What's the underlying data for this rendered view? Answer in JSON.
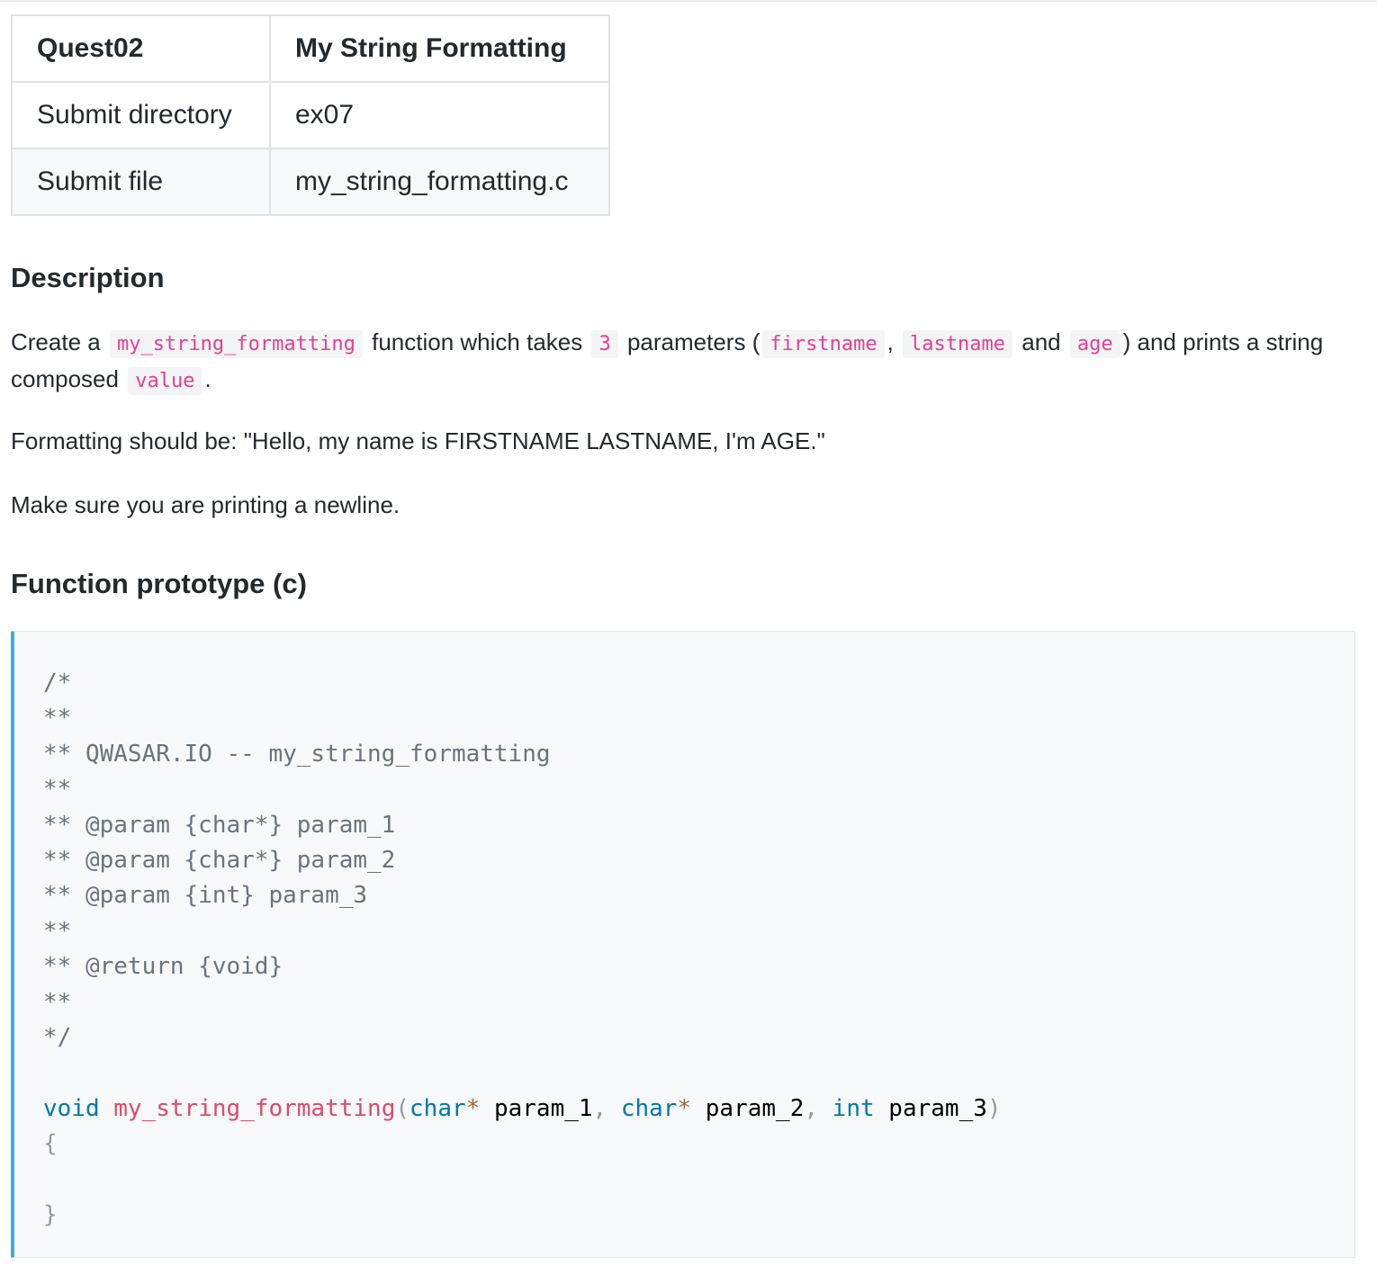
{
  "info_table": {
    "header": [
      "Quest02",
      "My String Formatting"
    ],
    "rows": [
      [
        "Submit directory",
        "ex07"
      ],
      [
        "Submit file",
        "my_string_formatting.c"
      ]
    ]
  },
  "description": {
    "heading": "Description",
    "p1": {
      "t1": "Create a",
      "c1": "my_string_formatting",
      "t2": "function which takes",
      "c2": "3",
      "t3": "parameters (",
      "c3": "firstname",
      "t4": ",",
      "c4": "lastname",
      "t5": "and",
      "c5": "age",
      "t6": ") and prints a string composed",
      "c6": "value",
      "t7": "."
    },
    "p2": "Formatting should be: \"Hello, my name is FIRSTNAME LASTNAME, I'm AGE.\"",
    "p3": "Make sure you are printing a newline."
  },
  "prototype": {
    "heading": "Function prototype (c)",
    "comment_lines": [
      "/*",
      "**",
      "** QWASAR.IO -- my_string_formatting",
      "**",
      "** @param {char*} param_1",
      "** @param {char*} param_2",
      "** @param {int} param_3",
      "**",
      "** @return {void}",
      "**",
      "*/"
    ],
    "signature": {
      "ret_type": "void",
      "fn_name": "my_string_formatting",
      "open_paren": "(",
      "type1": "char",
      "star1": "*",
      "name1": "param_1",
      "comma1": ",",
      "type2": "char",
      "star2": "*",
      "name2": "param_2",
      "comma2": ",",
      "type3": "int",
      "name3": "param_3",
      "close_paren": ")"
    },
    "open_brace": "{",
    "close_brace": "}"
  }
}
